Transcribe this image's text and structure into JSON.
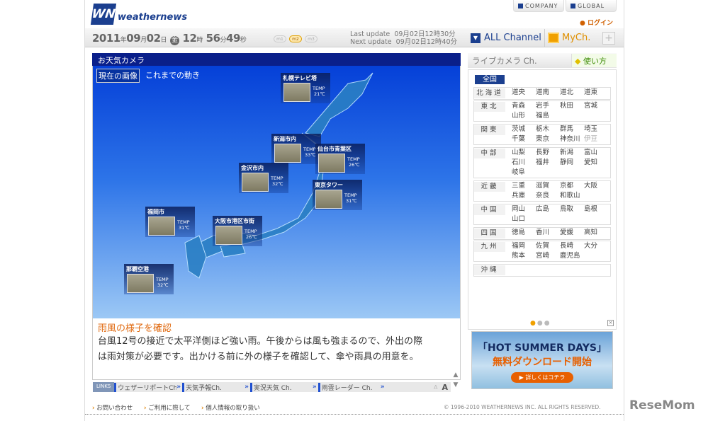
{
  "header": {
    "logo": "weathernews",
    "company": "COMPANY",
    "global": "GLOBAL",
    "login": "ログイン"
  },
  "datebar": {
    "year": "2011",
    "year_u": "年",
    "month": "09",
    "month_u": "月",
    "day": "02",
    "day_u": "日",
    "weekday": "金",
    "hour": "12",
    "hour_u": "時",
    "min": "56",
    "min_u": "分",
    "sec": "49",
    "sec_u": "秒",
    "modes": [
      "m1",
      "m2",
      "m3"
    ],
    "last_update": "Last update  09月02日12時30分",
    "next_update": "Next update  09月02日12時40分",
    "all_channel": "ALL Channel",
    "mych": "MyCh.",
    "plus": "+"
  },
  "main": {
    "title": "お天気カメラ",
    "tabs": [
      "現在の画像",
      "これまでの動き"
    ],
    "cameras": [
      {
        "name": "札幌テレビ塔",
        "temp_label": "TEMP",
        "temp": "21℃"
      },
      {
        "name": "新潟市内",
        "temp_label": "TEMP",
        "temp": "33℃"
      },
      {
        "name": "仙台市青葉区",
        "temp_label": "TEMP",
        "temp": "26℃"
      },
      {
        "name": "金沢市内",
        "temp_label": "TEMP",
        "temp": "32℃"
      },
      {
        "name": "東京タワー",
        "temp_label": "TEMP",
        "temp": "31℃"
      },
      {
        "name": "福岡市",
        "temp_label": "TEMP",
        "temp": "31℃"
      },
      {
        "name": "大阪市港区市街",
        "temp_label": "TEMP",
        "temp": "26℃"
      },
      {
        "name": "那覇空港",
        "temp_label": "TEMP",
        "temp": "32℃"
      }
    ],
    "news_title": "雨風の様子を確認",
    "news_body": "台風12号の接近で太平洋側ほど強い雨。午後からは風も強まるので、外出の際は雨対策が必要です。出かける前に外の様子を確認して、傘や雨具の用意を。",
    "links_label": "LINKS",
    "links": [
      "ウェザーリポートCh.",
      "天気予報Ch.",
      "実況天気 Ch.",
      "雨雲レーダー Ch."
    ],
    "font_small": "A",
    "font_large": "A"
  },
  "side": {
    "title": "ライブカメラ Ch.",
    "howto": "使い方",
    "all": "全国",
    "regions": [
      {
        "name": "北海道",
        "areas": [
          "道央",
          "道南",
          "道北",
          "道東"
        ]
      },
      {
        "name": "東北",
        "areas": [
          "青森",
          "岩手",
          "秋田",
          "宮城",
          "山形",
          "福島"
        ]
      },
      {
        "name": "関東",
        "areas": [
          "茨城",
          "栃木",
          "群馬",
          "埼玉",
          "千葉",
          "東京",
          "神奈川",
          "伊豆"
        ]
      },
      {
        "name": "中部",
        "areas": [
          "山梨",
          "長野",
          "新潟",
          "富山",
          "石川",
          "福井",
          "静岡",
          "愛知",
          "岐阜"
        ]
      },
      {
        "name": "近畿",
        "areas": [
          "三重",
          "滋賀",
          "京都",
          "大阪",
          "兵庫",
          "奈良",
          "和歌山"
        ]
      },
      {
        "name": "中国",
        "areas": [
          "岡山",
          "広島",
          "鳥取",
          "島根",
          "山口"
        ]
      },
      {
        "name": "四国",
        "areas": [
          "徳島",
          "香川",
          "愛媛",
          "高知"
        ]
      },
      {
        "name": "九州",
        "areas": [
          "福岡",
          "佐賀",
          "長崎",
          "大分",
          "熊本",
          "宮崎",
          "鹿児島"
        ]
      },
      {
        "name": "沖縄",
        "areas": []
      }
    ],
    "ad": {
      "line1": "「HOT SUMMER DAYS」",
      "line2": "無料ダウンロード開始",
      "button": "▶ 詳しくはコチラ"
    }
  },
  "footer": {
    "links": [
      "お問い合わせ",
      "ご利用に際して",
      "個人情報の取り扱い"
    ],
    "copyright": "© 1996-2010 WEATHERNEWS INC. ALL RIGHTS RESERVED.",
    "watermark": "ReseMom"
  }
}
